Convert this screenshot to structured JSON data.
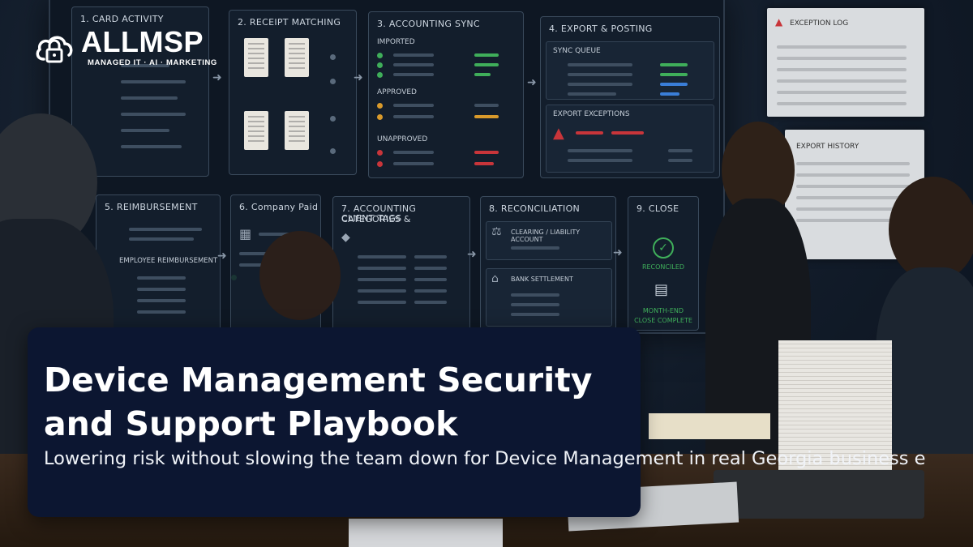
{
  "brand": {
    "name": "ALLMSP",
    "tagline": "MANAGED IT · AI · MARKETING",
    "colors": {
      "card_bg": "#0c1631",
      "text": "#ffffff"
    },
    "icon": "cloud-lock-icon"
  },
  "hero": {
    "title_line1": "Device Management Security",
    "title_line2": "and Support Playbook",
    "subtitle": "Lowering risk without slowing the team down for Device Management in real Georgia business e"
  },
  "board": {
    "panels": {
      "p1": "1. CARD ACTIVITY",
      "p2": "2. RECEIPT MATCHING",
      "p3": "3. ACCOUNTING SYNC",
      "p3_imported": "IMPORTED",
      "p3_approved": "APPROVED",
      "p3_unapproved": "UNAPPROVED",
      "p4": "4. EXPORT & POSTING",
      "p4_queue": "SYNC QUEUE",
      "p4_exceptions": "EXPORT EXCEPTIONS",
      "p5": "5. REIMBURSEMENT",
      "p5_sub": "EMPLOYEE REIMBURSEMENT",
      "p6": "6. Company Paid",
      "p7_a": "7. ACCOUNTING CATEGORIES &",
      "p7_b": "CLIENT TAGS",
      "p8": "8. RECONCILIATION",
      "p8_a": "CLEARING / LIABILITY ACCOUNT",
      "p8_b": "BANK SETTLEMENT",
      "p9": "9. CLOSE",
      "p9_a": "RECONCILED",
      "p9_b1": "MONTH-END",
      "p9_b2": "CLOSE COMPLETE"
    },
    "posters": {
      "exception": "EXCEPTION LOG",
      "export": "EXPORT HISTORY"
    }
  }
}
